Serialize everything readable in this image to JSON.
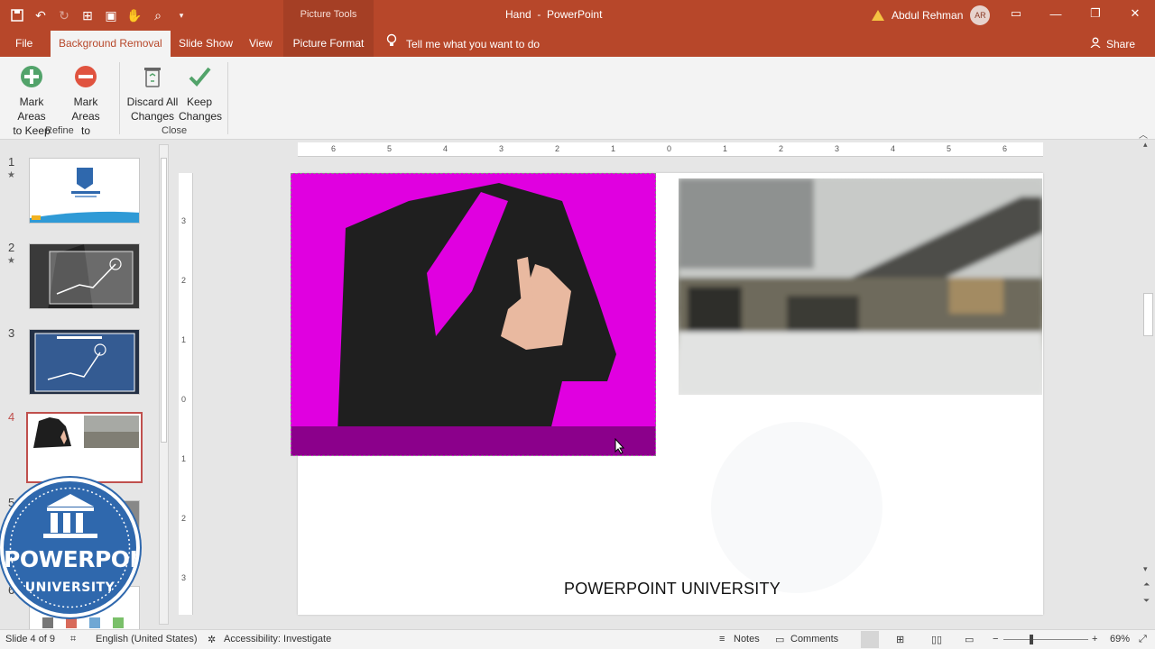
{
  "titlebar": {
    "context_label": "Picture Tools",
    "doc_name": "Hand",
    "app_name": "PowerPoint",
    "user_name": "Abdul Rehman",
    "user_initials": "AR"
  },
  "tabs": {
    "file": "File",
    "background_removal": "Background Removal",
    "slide_show": "Slide Show",
    "view": "View",
    "picture_format": "Picture Format",
    "tell_me": "Tell me what you want to do",
    "share": "Share"
  },
  "ribbon": {
    "mark_keep_line1": "Mark Areas",
    "mark_keep_line2": "to Keep",
    "mark_remove_line1": "Mark Areas",
    "mark_remove_line2": "to Remove",
    "discard_line1": "Discard All",
    "discard_line2": "Changes",
    "keep_line1": "Keep",
    "keep_line2": "Changes",
    "group_refine": "Refine",
    "group_close": "Close"
  },
  "thumbnails": [
    {
      "number": "1",
      "star": "★"
    },
    {
      "number": "2",
      "star": "★"
    },
    {
      "number": "3",
      "star": ""
    },
    {
      "number": "4",
      "star": ""
    },
    {
      "number": "5",
      "star": ""
    },
    {
      "number": "6",
      "star": ""
    }
  ],
  "ruler": {
    "h_labels": [
      "6",
      "5",
      "4",
      "3",
      "2",
      "1",
      "0",
      "1",
      "2",
      "3",
      "4",
      "5",
      "6"
    ],
    "v_labels": [
      "3",
      "2",
      "1",
      "0",
      "1",
      "2",
      "3"
    ]
  },
  "slide": {
    "caption": "POWERPOINT UNIVERSITY"
  },
  "logo": {
    "line1": "POWERPOINT",
    "line2": "UNIVERSITY"
  },
  "statusbar": {
    "slide_info": "Slide 4 of 9",
    "language": "English (United States)",
    "accessibility": "Accessibility: Investigate",
    "notes": "Notes",
    "comments": "Comments",
    "zoom": "69%"
  },
  "colors": {
    "accent": "#b7472a",
    "removal_overlay": "#e000e0"
  }
}
